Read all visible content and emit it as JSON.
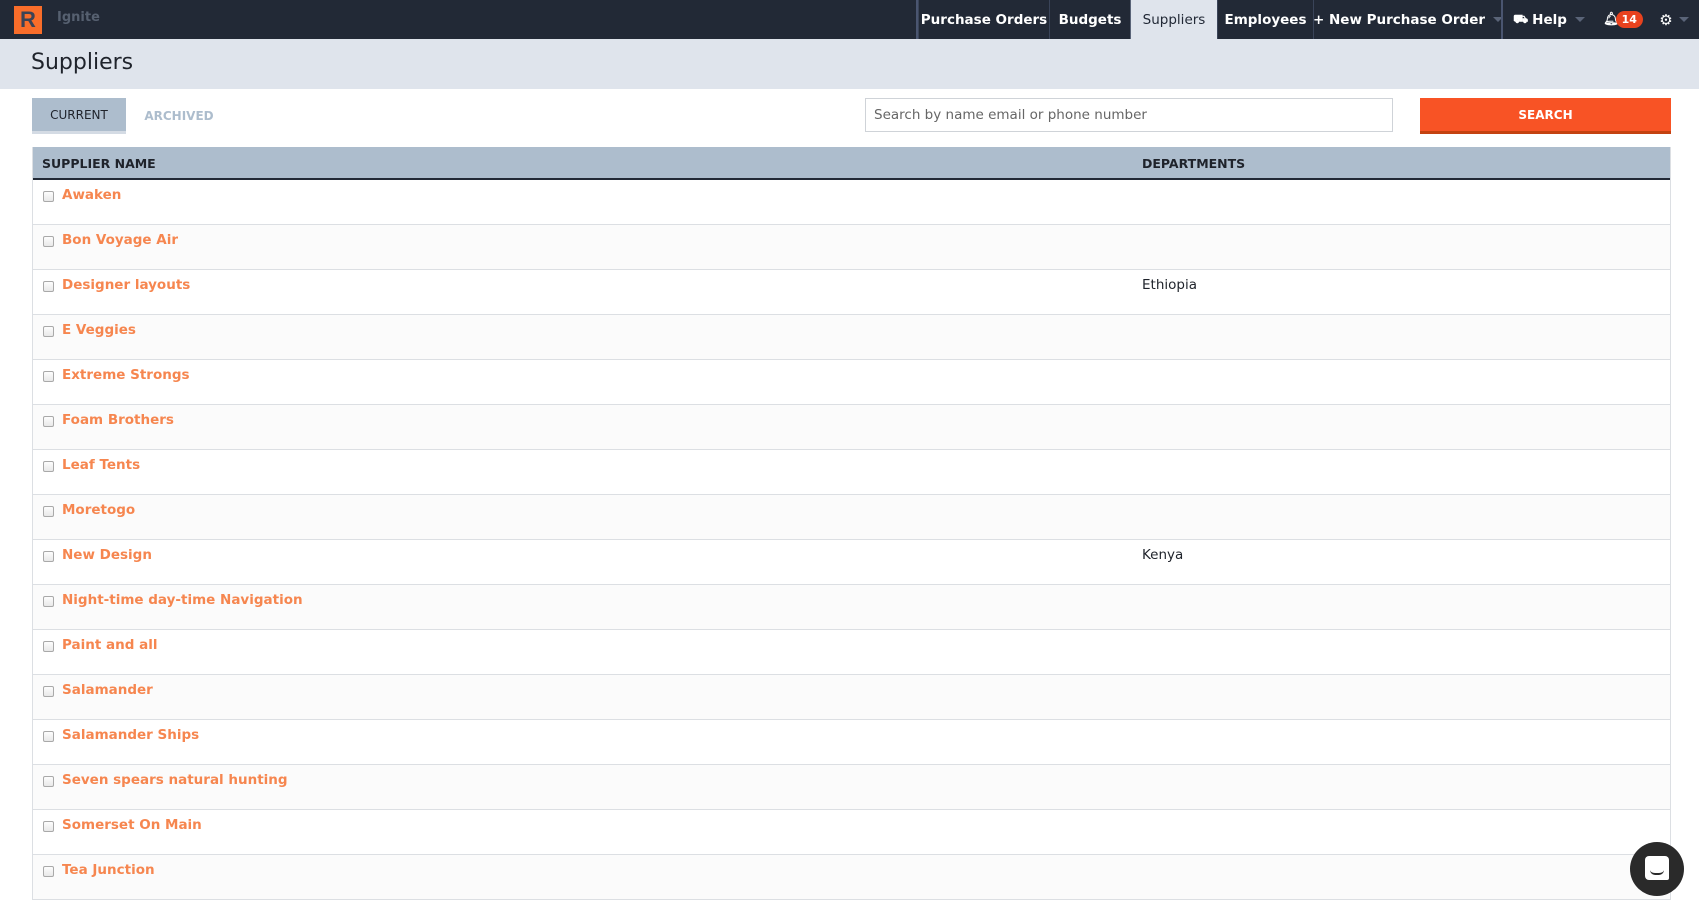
{
  "app": {
    "logo_letter": "R",
    "org_name": "Ignite"
  },
  "nav": {
    "items": [
      {
        "label": "Purchase Orders"
      },
      {
        "label": "Budgets"
      },
      {
        "label": "Suppliers",
        "active": true
      },
      {
        "label": "Employees"
      },
      {
        "label": "+ New Purchase Order"
      }
    ],
    "help_label": "Help",
    "notification_count": "14"
  },
  "page": {
    "title": "Suppliers"
  },
  "tabs": {
    "current": "CURRENT",
    "archived": "ARCHIVED"
  },
  "search": {
    "placeholder": "Search by name email or phone number",
    "value": "",
    "button_label": "SEARCH"
  },
  "table": {
    "columns": [
      "SUPPLIER NAME",
      "DEPARTMENTS"
    ],
    "rows": [
      {
        "name": "Awaken",
        "department": ""
      },
      {
        "name": "Bon Voyage Air",
        "department": ""
      },
      {
        "name": "Designer layouts",
        "department": "Ethiopia"
      },
      {
        "name": "E Veggies",
        "department": ""
      },
      {
        "name": "Extreme Strongs",
        "department": ""
      },
      {
        "name": "Foam Brothers",
        "department": ""
      },
      {
        "name": "Leaf Tents",
        "department": ""
      },
      {
        "name": "Moretogo",
        "department": ""
      },
      {
        "name": "New Design",
        "department": "Kenya"
      },
      {
        "name": "Night-time day-time Navigation",
        "department": ""
      },
      {
        "name": "Paint and all",
        "department": ""
      },
      {
        "name": "Salamander",
        "department": ""
      },
      {
        "name": "Salamander Ships",
        "department": ""
      },
      {
        "name": "Seven spears natural hunting",
        "department": ""
      },
      {
        "name": "Somerset On Main",
        "department": ""
      },
      {
        "name": "Tea Junction",
        "department": ""
      }
    ]
  },
  "colors": {
    "brand": "#f96d2a",
    "accent": "#f85325",
    "link": "#f6864f",
    "nav_bg": "#222936"
  }
}
